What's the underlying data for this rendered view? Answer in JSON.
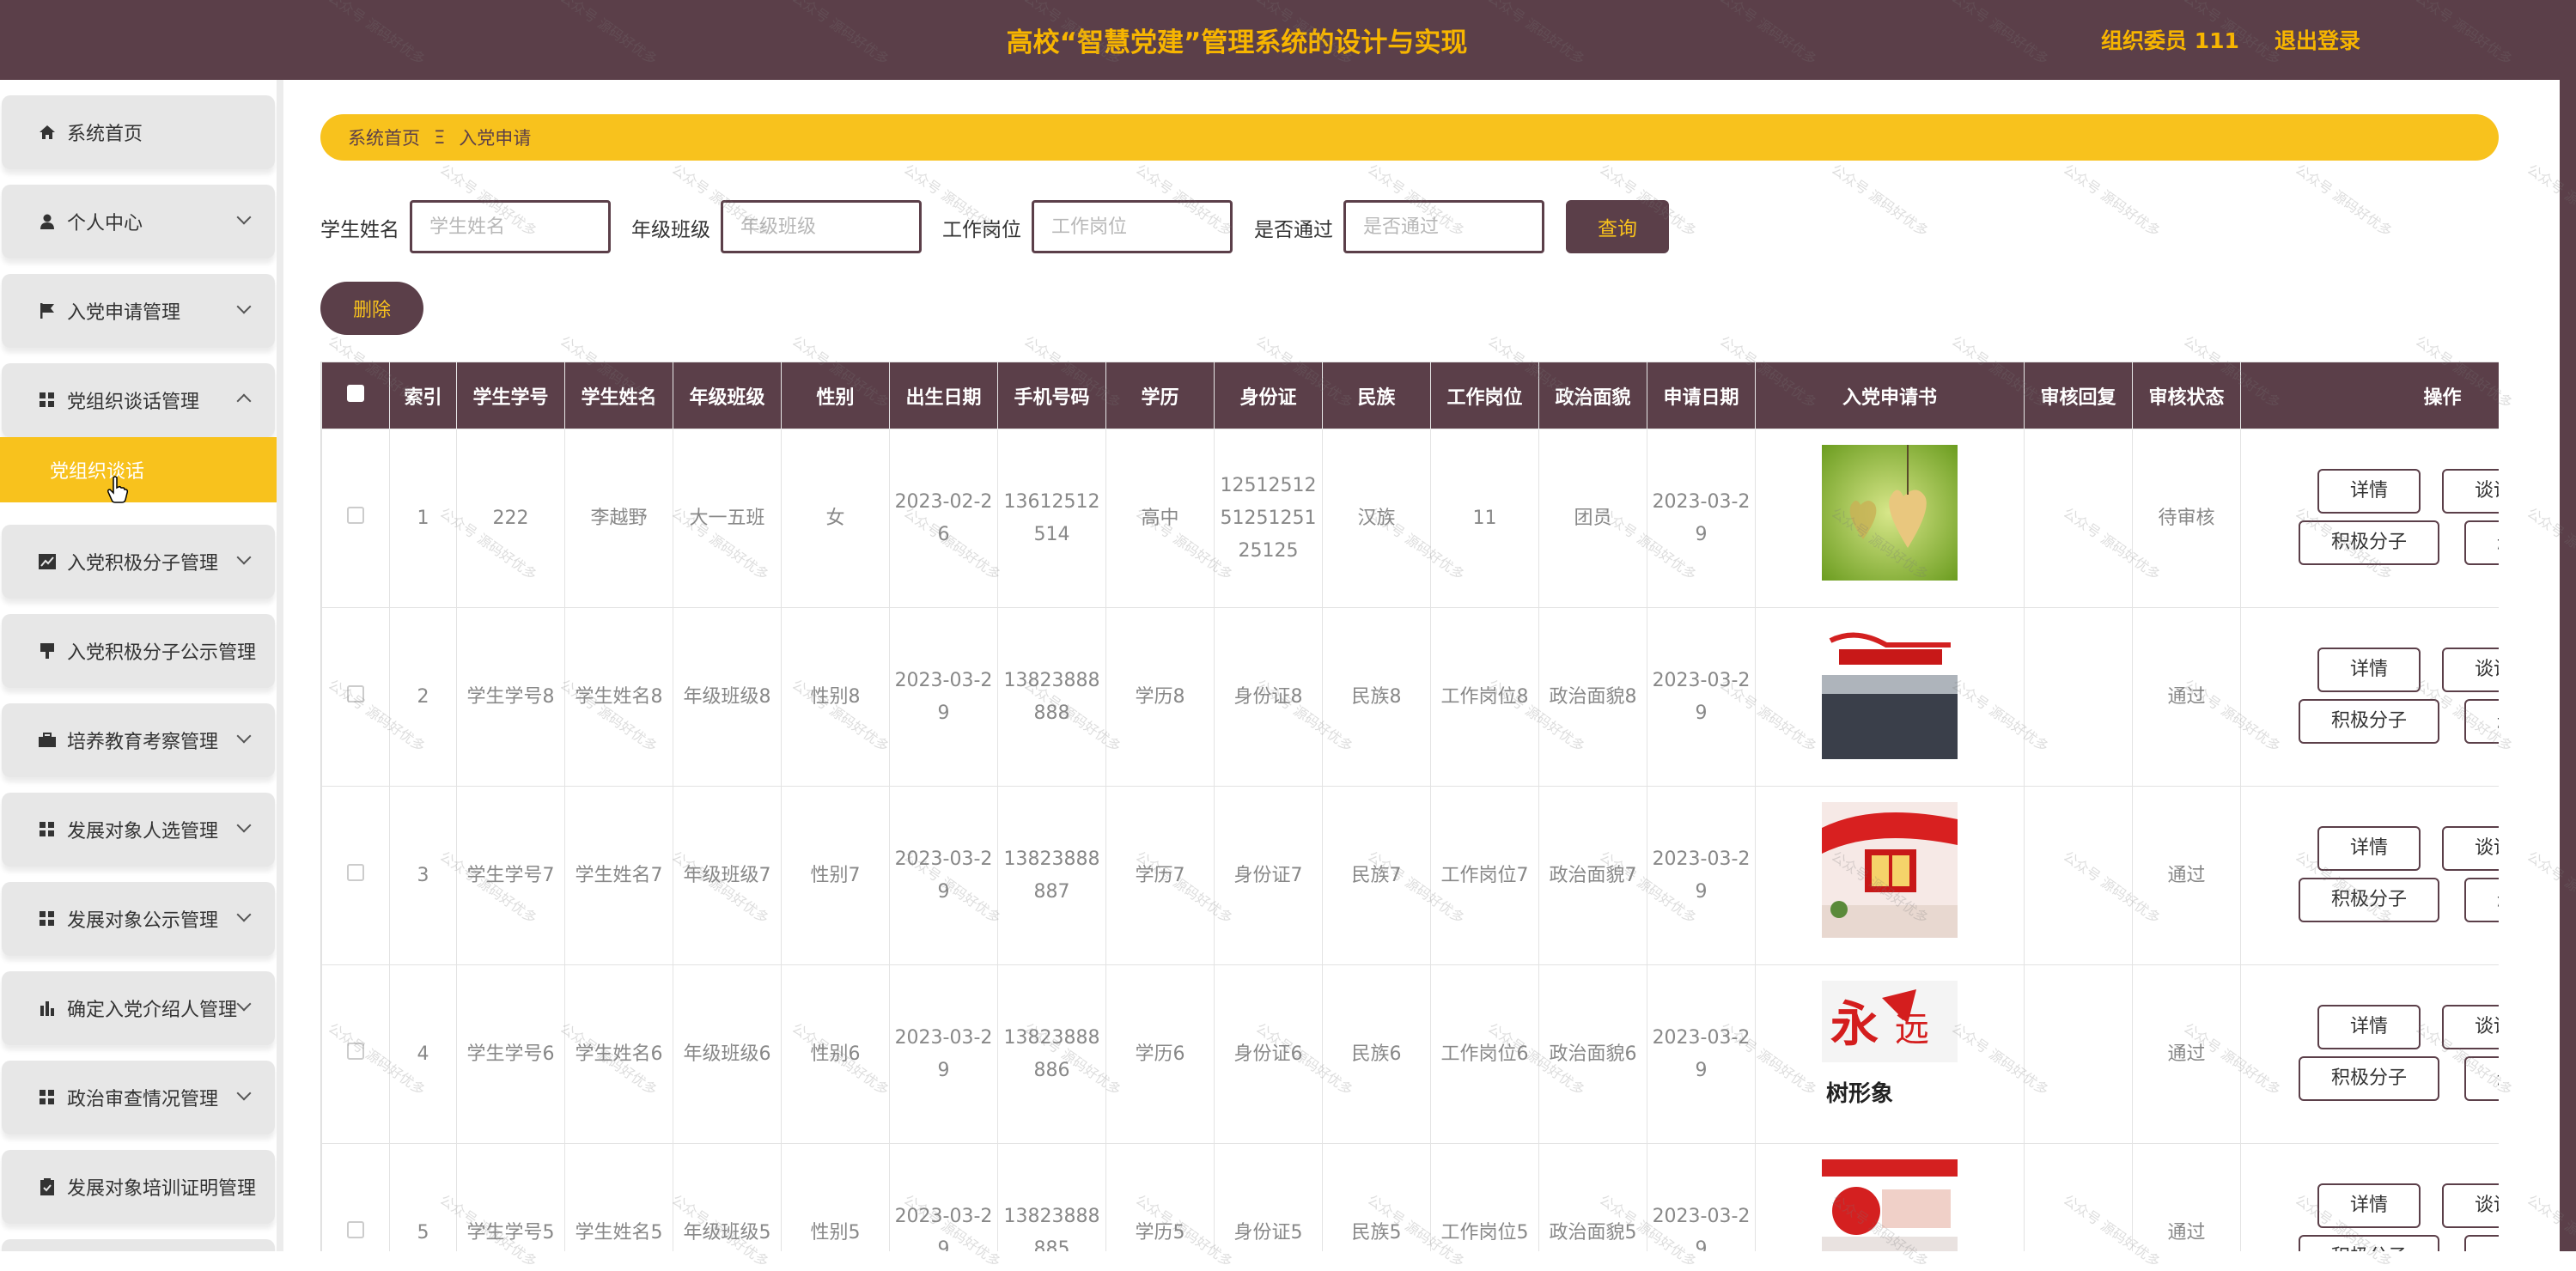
{
  "header": {
    "title": "高校“智慧党建”管理系统的设计与实现",
    "user": "组织委员 111",
    "logout": "退出登录"
  },
  "sidebar": {
    "items": [
      {
        "label": "系统首页",
        "icon": "home-icon"
      },
      {
        "label": "个人中心",
        "icon": "person-icon"
      },
      {
        "label": "入党申请管理",
        "icon": "flag-icon"
      },
      {
        "label": "党组织谈话管理",
        "icon": "grid-icon",
        "expanded": true
      },
      {
        "label": "入党积极分子管理",
        "icon": "chart-icon"
      },
      {
        "label": "入党积极分子公示管理",
        "icon": "sign-icon"
      },
      {
        "label": "培养教育考察管理",
        "icon": "briefcase-icon"
      },
      {
        "label": "发展对象人选管理",
        "icon": "grid-icon"
      },
      {
        "label": "发展对象公示管理",
        "icon": "grid-icon"
      },
      {
        "label": "确定入党介绍人管理",
        "icon": "bar-chart-icon"
      },
      {
        "label": "政治审查情况管理",
        "icon": "grid-icon"
      },
      {
        "label": "发展对象培训证明管理",
        "icon": "clipboard-icon"
      }
    ],
    "submenu_active": "党组织谈话"
  },
  "breadcrumb": {
    "home": "系统首页",
    "separator": "Ξ",
    "current": "入党申请"
  },
  "search": {
    "fields": [
      {
        "label": "学生姓名",
        "placeholder": "学生姓名"
      },
      {
        "label": "年级班级",
        "placeholder": "年级班级"
      },
      {
        "label": "工作岗位",
        "placeholder": "工作岗位"
      },
      {
        "label": "是否通过",
        "placeholder": "是否通过"
      }
    ],
    "query_button": "查询",
    "delete_button": "删除"
  },
  "table": {
    "headers": [
      "索引",
      "学生学号",
      "学生姓名",
      "年级班级",
      "性别",
      "出生日期",
      "手机号码",
      "学历",
      "身份证",
      "民族",
      "工作岗位",
      "政治面貌",
      "申请日期",
      "入党申请书",
      "审核回复",
      "审核状态",
      "操作"
    ],
    "rows": [
      {
        "index": "1",
        "student_no": "222",
        "name": "李越野",
        "class": "大一五班",
        "gender": "女",
        "birth": "2023-02-26",
        "phone": "13612512514",
        "edu": "高中",
        "id_card": "1251251251251251 25125",
        "nation": "汉族",
        "post": "11",
        "political": "团员",
        "apply_date": "2023-03-29",
        "image": "hearts",
        "reply": "",
        "status": "待审核"
      },
      {
        "index": "2",
        "student_no": "学生学号8",
        "name": "学生姓名8",
        "class": "年级班级8",
        "gender": "性别8",
        "birth": "2023-03-29",
        "phone": "13823888888",
        "edu": "学历8",
        "id_card": "身份证8",
        "nation": "民族8",
        "post": "工作岗位8",
        "political": "政治面貌8",
        "apply_date": "2023-03-29",
        "image": "party-wall",
        "reply": "",
        "status": "通过"
      },
      {
        "index": "3",
        "student_no": "学生学号7",
        "name": "学生姓名7",
        "class": "年级班级7",
        "gender": "性别7",
        "birth": "2023-03-29",
        "phone": "13823888887",
        "edu": "学历7",
        "id_card": "身份证7",
        "nation": "民族7",
        "post": "工作岗位7",
        "political": "政治面貌7",
        "apply_date": "2023-03-29",
        "image": "red-room",
        "reply": "",
        "status": "通过"
      },
      {
        "index": "4",
        "student_no": "学生学号6",
        "name": "学生姓名6",
        "class": "年级班级6",
        "gender": "性别6",
        "birth": "2023-03-29",
        "phone": "13823888886",
        "edu": "学历6",
        "id_card": "身份证6",
        "nation": "民族6",
        "post": "工作岗位6",
        "political": "政治面貌6",
        "apply_date": "2023-03-29",
        "image": "slogan",
        "reply": "",
        "status": "通过"
      },
      {
        "index": "5",
        "student_no": "学生学号5",
        "name": "学生姓名5",
        "class": "年级班级5",
        "gender": "性别5",
        "birth": "2023-03-29",
        "phone": "13823888885",
        "edu": "学历5",
        "id_card": "身份证5",
        "nation": "民族5",
        "post": "工作岗位5",
        "political": "政治面貌5",
        "apply_date": "2023-03-29",
        "image": "banner",
        "reply": "",
        "status": "通过"
      }
    ],
    "row_buttons": {
      "detail": "详情",
      "talk": "谈话",
      "activist": "积极分子",
      "delete": "删除"
    }
  },
  "watermark": "公众号 源码好优多",
  "colors": {
    "primary": "#5b3f49",
    "accent": "#f8c21d"
  }
}
